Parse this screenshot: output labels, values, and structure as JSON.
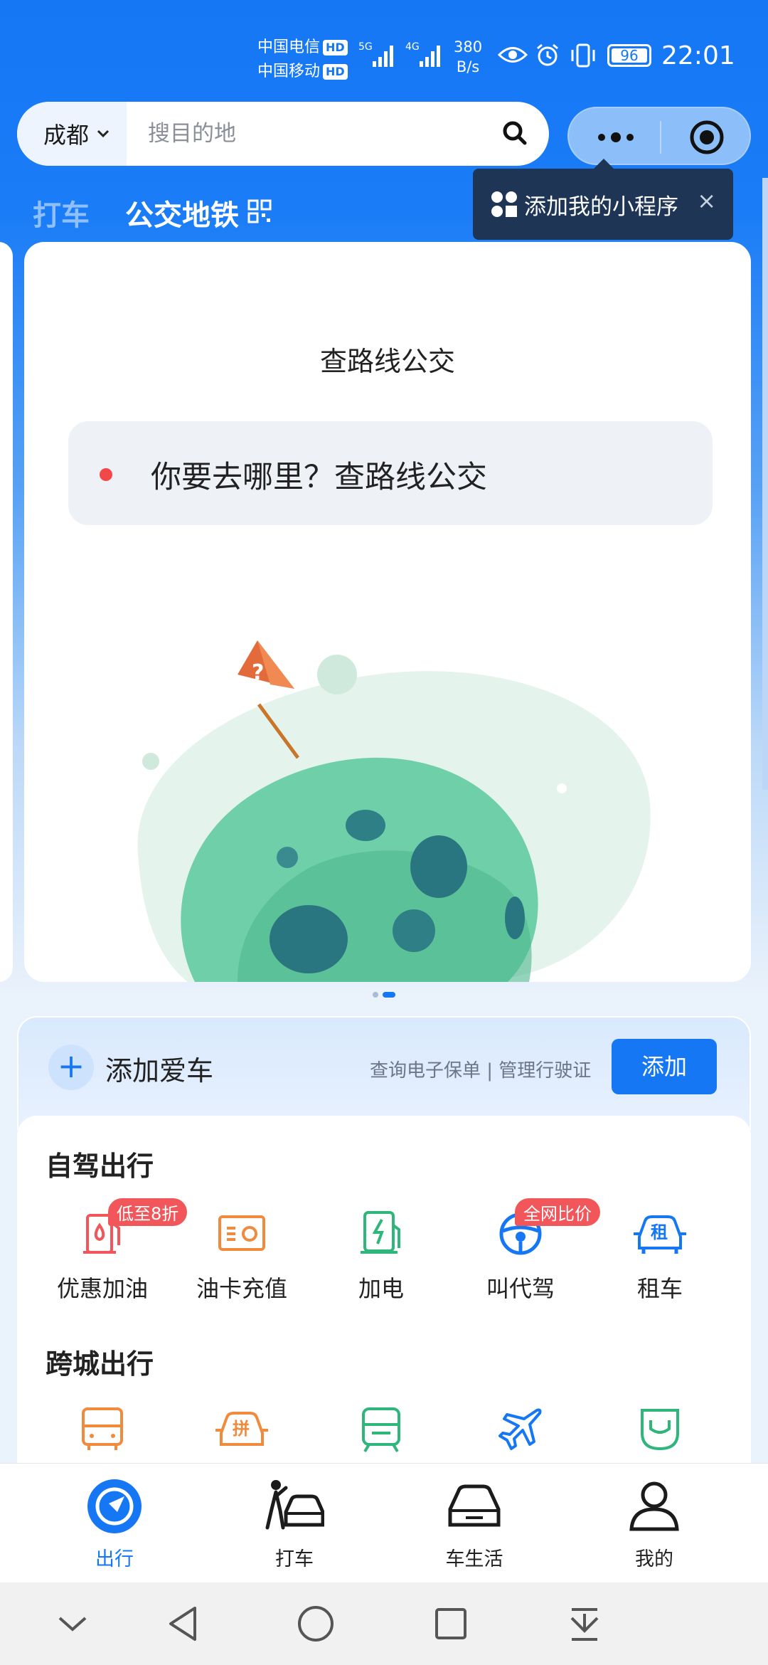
{
  "status_bar": {
    "carrier1": "中国电信",
    "carrier2": "中国移动",
    "hd": "HD",
    "net1": "5G",
    "net2": "4G",
    "speed_value": "380",
    "speed_unit": "B/s",
    "battery": "96",
    "time": "22:01"
  },
  "search": {
    "city": "成都",
    "placeholder": "搜目的地"
  },
  "tabs": {
    "taxi": "打车",
    "bus_metro": "公交地铁"
  },
  "tooltip": {
    "text": "添加我的小程序",
    "close": "×"
  },
  "card": {
    "title": "查路线公交",
    "destination_prompt": "你要去哪里？查路线公交"
  },
  "add_car": {
    "plus": "+",
    "title": "添加爱车",
    "links": "查询电子保单 | 管理行驶证",
    "button": "添加"
  },
  "self_drive": {
    "title": "自驾出行",
    "items": [
      {
        "label": "优惠加油",
        "badge": "低至8折",
        "icon": "fuel-pump-icon"
      },
      {
        "label": "油卡充值",
        "badge": "",
        "icon": "fuel-card-icon"
      },
      {
        "label": "加电",
        "badge": "",
        "icon": "ev-charger-icon"
      },
      {
        "label": "叫代驾",
        "badge": "全网比价",
        "icon": "steering-wheel-icon"
      },
      {
        "label": "租车",
        "badge": "",
        "icon": "rental-car-icon"
      }
    ],
    "rental_glyph": "租"
  },
  "intercity": {
    "title": "跨城出行",
    "carpool_glyph": "拼",
    "icons": [
      "bus-icon",
      "carpool-icon",
      "train-icon",
      "airplane-icon",
      "ship-icon"
    ]
  },
  "bottom_nav": {
    "items": [
      {
        "label": "出行",
        "active": true
      },
      {
        "label": "打车",
        "active": false
      },
      {
        "label": "车生活",
        "active": false
      },
      {
        "label": "我的",
        "active": false
      }
    ]
  },
  "colors": {
    "primary": "#1677f5",
    "badge": "#f0565a",
    "orange": "#f08a3c",
    "green": "#2fb67a"
  }
}
